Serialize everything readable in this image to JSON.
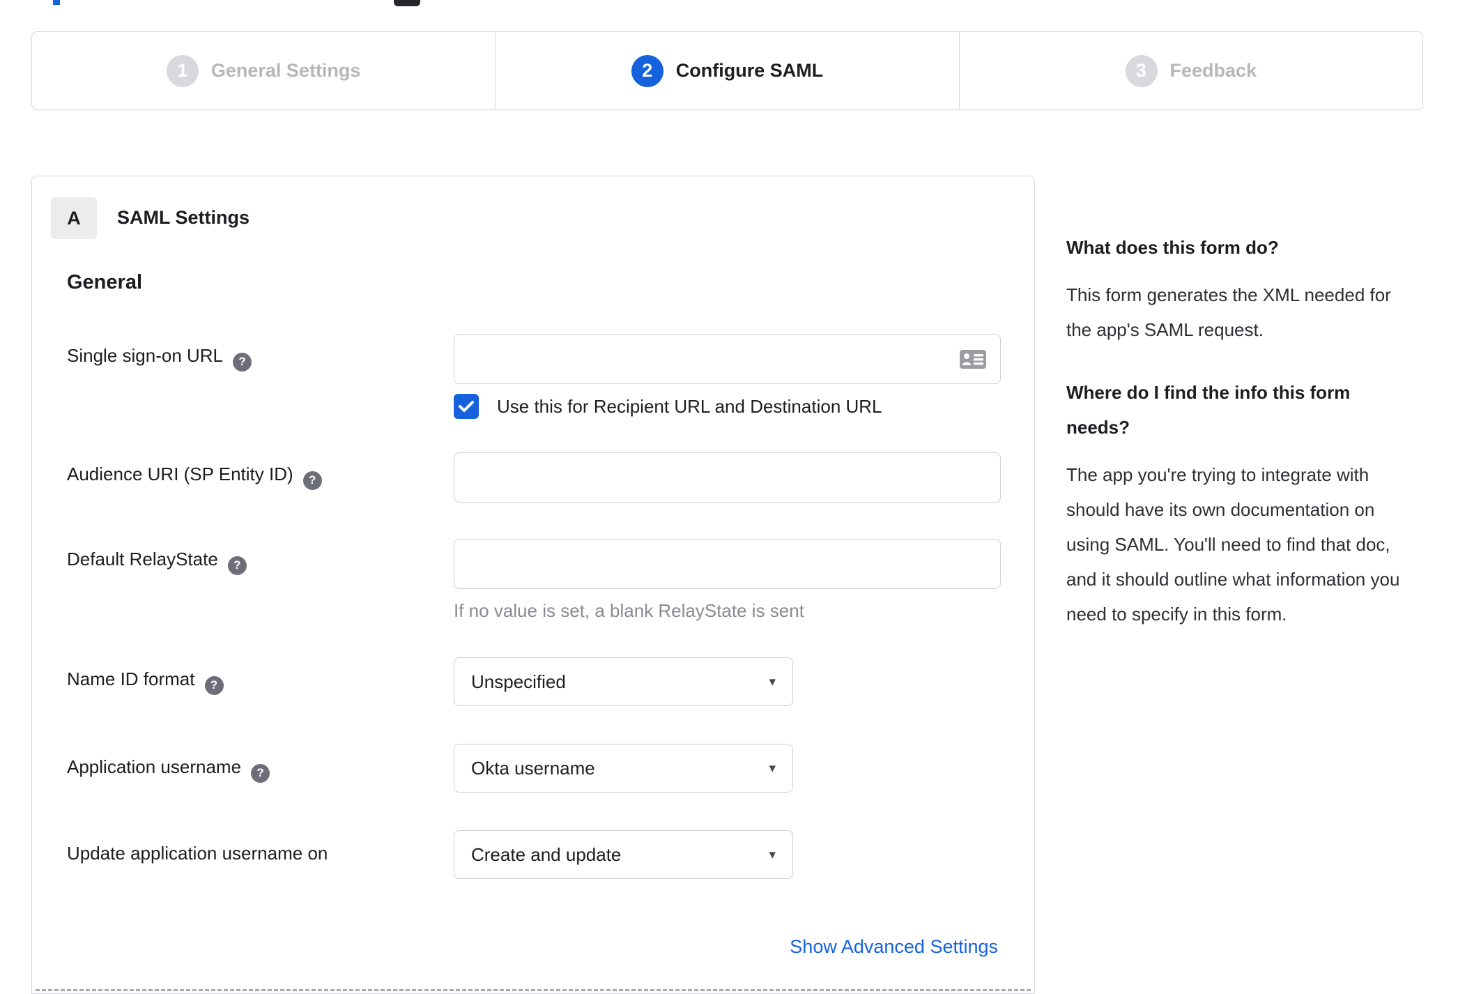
{
  "stepper": {
    "active_step": 2,
    "steps": [
      {
        "number": "1",
        "label": "General Settings"
      },
      {
        "number": "2",
        "label": "Configure SAML"
      },
      {
        "number": "3",
        "label": "Feedback"
      }
    ]
  },
  "panel": {
    "badge": "A",
    "title": "SAML Settings",
    "section_heading": "General",
    "fields": {
      "sso": {
        "label": "Single sign-on URL",
        "value": "",
        "checkbox_label": "Use this for Recipient URL and Destination URL",
        "checkbox_checked": true
      },
      "audience": {
        "label": "Audience URI (SP Entity ID)",
        "value": ""
      },
      "relay": {
        "label": "Default RelayState",
        "value": "",
        "hint": "If no value is set, a blank RelayState is sent"
      },
      "name_id": {
        "label": "Name ID format",
        "value": "Unspecified"
      },
      "app_username": {
        "label": "Application username",
        "value": "Okta username"
      },
      "update_username": {
        "label": "Update application username on",
        "value": "Create and update"
      }
    },
    "advanced_link": "Show Advanced Settings"
  },
  "help_panel": {
    "q1": "What does this form do?",
    "a1": "This form generates the XML needed for the app's SAML request.",
    "q2": "Where do I find the info this form needs?",
    "a2": "The app you're trying to integrate with should have its own documentation on using SAML. You'll need to find that doc, and it should outline what information you need to specify in this form."
  },
  "icons": {
    "help": "?",
    "caret": "▾"
  },
  "colors": {
    "accent": "#1662dd",
    "inactive_gray": "#d9d9dd",
    "label_dark": "#1d1d21",
    "muted_text": "#8a8a91",
    "border": "#d8d8dc"
  }
}
